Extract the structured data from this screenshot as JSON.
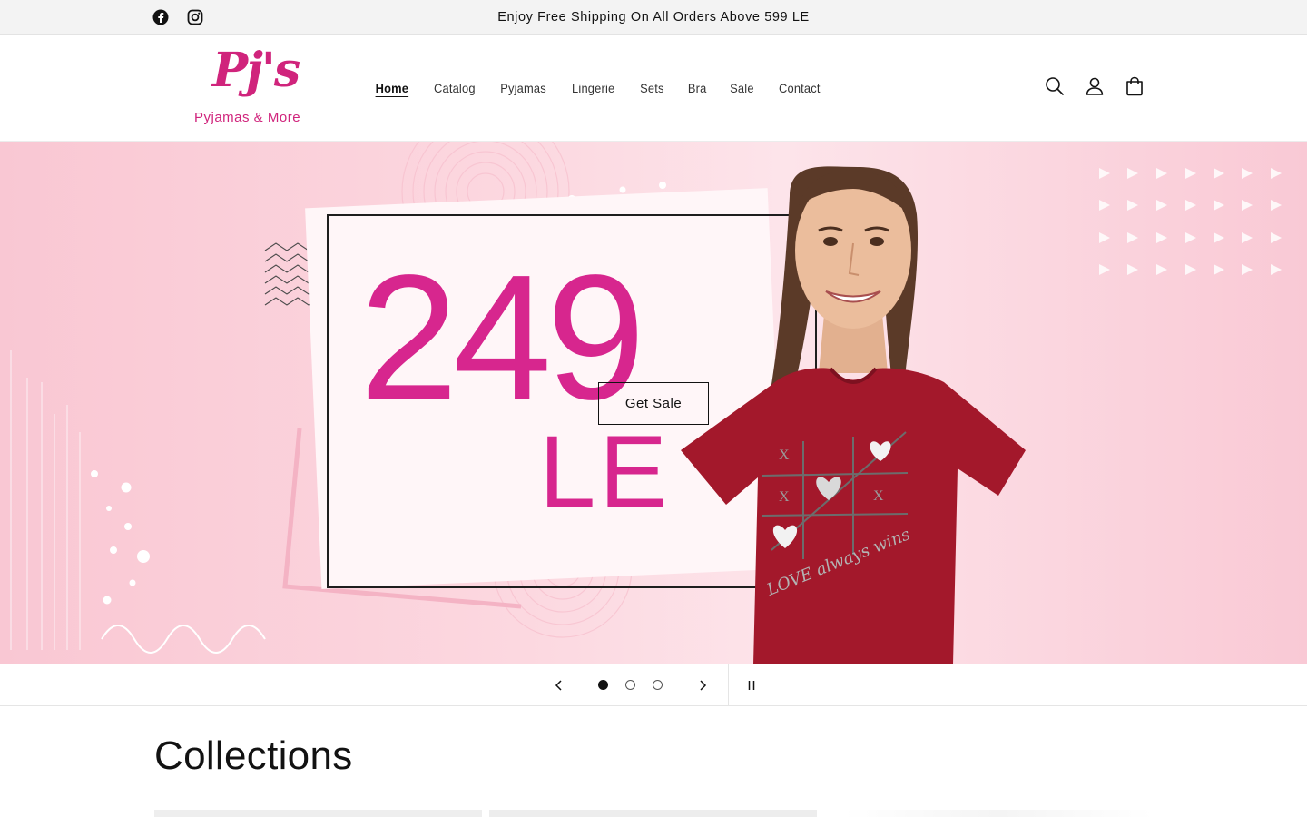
{
  "announcement": {
    "text": "Enjoy Free Shipping On All Orders Above 599 LE",
    "social_icons": [
      "facebook-icon",
      "instagram-icon"
    ]
  },
  "header": {
    "logo_mark": "Pj's",
    "logo_tagline": "Pyjamas & More",
    "nav": [
      {
        "label": "Home",
        "active": true
      },
      {
        "label": "Catalog",
        "active": false
      },
      {
        "label": "Pyjamas",
        "active": false
      },
      {
        "label": "Lingerie",
        "active": false
      },
      {
        "label": "Sets",
        "active": false
      },
      {
        "label": "Bra",
        "active": false
      },
      {
        "label": "Sale",
        "active": false
      },
      {
        "label": "Contact",
        "active": false
      }
    ],
    "icons": [
      "search-icon",
      "account-icon",
      "cart-icon"
    ]
  },
  "hero": {
    "price": "249",
    "currency": "LE",
    "cta_label": "Get Sale",
    "tshirt_text": "LOVE always wins",
    "colors": {
      "accent": "#d7268e",
      "shirt": "#a3182b",
      "background": "#fcd8e0"
    }
  },
  "slider": {
    "slide_count": 3,
    "active_index": 1,
    "icons": [
      "chevron-left-icon",
      "chevron-right-icon",
      "pause-icon"
    ]
  },
  "collections": {
    "heading": "Collections"
  },
  "colors": {
    "brand": "#d0247c",
    "text": "#121212",
    "announce_bg": "#f3f3f3"
  }
}
